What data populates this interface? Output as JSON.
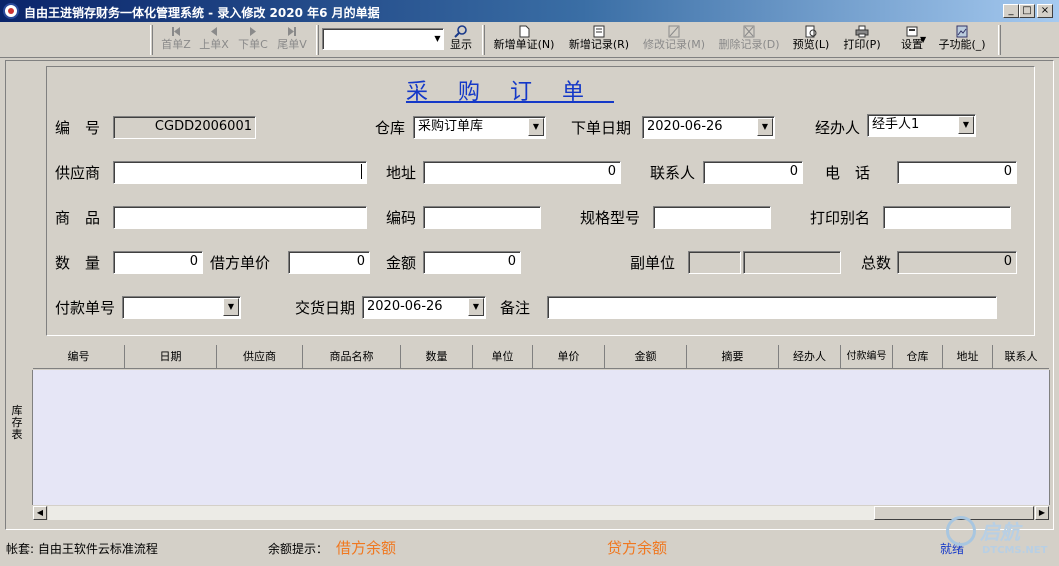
{
  "window": {
    "title": "自由王进销存财务一体化管理系统 - 录入修改 2020 年6 月的单据",
    "min": "_",
    "max": "□",
    "close": "×"
  },
  "toolbar": {
    "first": "首单Z",
    "prev": "上单X",
    "next": "下单C",
    "last": "尾单V",
    "combo_value": "",
    "show": "显示",
    "new_doc": "新增单证(N)",
    "new_record": "新增记录(R)",
    "edit_record": "修改记录(M)",
    "delete_record": "删除记录(D)",
    "preview": "预览(L)",
    "print": "打印(P)",
    "settings": "设置",
    "subfunc": "子功能(_)"
  },
  "side_tab": "库存表",
  "form": {
    "title": "采购订单",
    "labels": {
      "number": "编　号",
      "warehouse": "仓库",
      "order_date": "下单日期",
      "handler": "经办人",
      "supplier": "供应商",
      "address": "地址",
      "contact": "联系人",
      "phone": "电　话",
      "product": "商　品",
      "code": "编码",
      "spec": "规格型号",
      "print_alias": "打印别名",
      "qty": "数　量",
      "unit_price": "借方单价",
      "amount": "金额",
      "sub_unit": "副单位",
      "total": "总数",
      "payment_no": "付款单号",
      "delivery_date": "交货日期",
      "remark": "备注"
    },
    "values": {
      "number": "CGDD2006001",
      "warehouse": "采购订单库",
      "order_date": "2020-06-26",
      "handler": "经手人1",
      "supplier": "",
      "address": "0",
      "contact": "0",
      "phone": "0",
      "product": "",
      "code": "",
      "spec": "",
      "print_alias": "",
      "qty": "0",
      "unit_price": "0",
      "amount": "0",
      "sub_unit_a": "",
      "sub_unit_b": "",
      "total": "0",
      "payment_no": "",
      "delivery_date": "2020-06-26",
      "remark": ""
    }
  },
  "grid": {
    "columns": [
      "编号",
      "日期",
      "供应商",
      "商品名称",
      "数量",
      "单位",
      "单价",
      "金额",
      "摘要",
      "经办人",
      "付款编号",
      "仓库",
      "地址",
      "联系人"
    ]
  },
  "status": {
    "account": "帐套: 自由王软件云标准流程",
    "balance_hint": "余额提示：",
    "debit_balance": "借方余额",
    "credit_balance": "贷方余额",
    "ready": "就绪"
  },
  "watermark": {
    "brand": "启航",
    "sub": "DTCMS.NET"
  },
  "colors": {
    "title_blue": "#1438c8",
    "balance_orange": "#f07820",
    "grid_bg": "#e6e6f6"
  }
}
